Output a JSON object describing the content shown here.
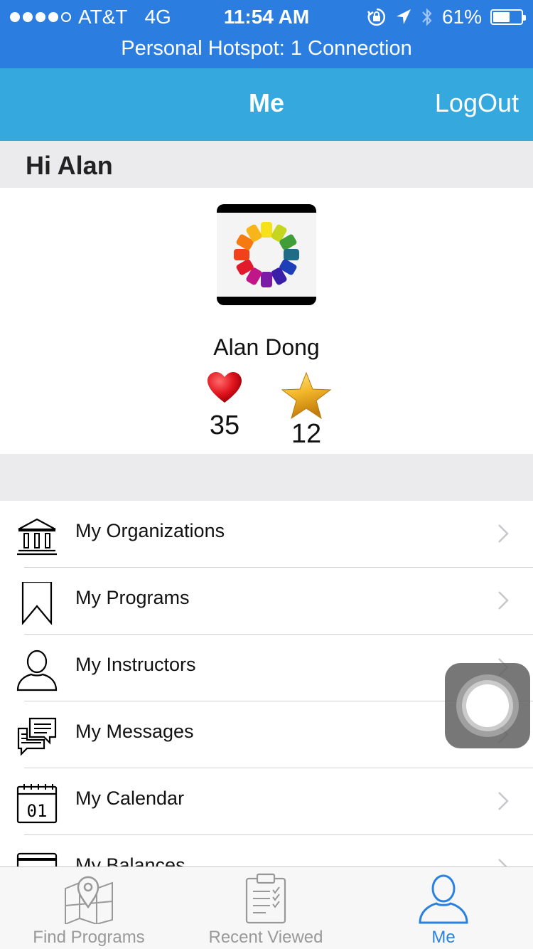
{
  "status_bar": {
    "carrier": "AT&T",
    "network": "4G",
    "time": "11:54 AM",
    "battery_percent_text": "61%",
    "battery_level": 0.61,
    "hotspot": "Personal Hotspot: 1 Connection"
  },
  "nav": {
    "title": "Me",
    "logout": "LogOut"
  },
  "greeting": "Hi Alan",
  "profile": {
    "name": "Alan Dong",
    "likes": "35",
    "stars": "12",
    "avatar_icon": "color-wheel"
  },
  "menu": {
    "items": [
      {
        "label": "My Organizations",
        "icon": "institution-icon"
      },
      {
        "label": "My Programs",
        "icon": "bookmark-icon"
      },
      {
        "label": "My Instructors",
        "icon": "person-icon"
      },
      {
        "label": "My Messages",
        "icon": "messages-icon"
      },
      {
        "label": "My Calendar",
        "icon": "calendar-icon"
      },
      {
        "label": "My Balances",
        "icon": "card-icon"
      }
    ]
  },
  "tabs": [
    {
      "label": "Find Programs",
      "icon": "map-pin-icon",
      "active": false
    },
    {
      "label": "Recent Viewed",
      "icon": "clipboard-icon",
      "active": false
    },
    {
      "label": "Me",
      "icon": "person-icon",
      "active": true
    }
  ],
  "colors": {
    "status_bar": "#2b7de0",
    "nav_bar": "#35a9dd",
    "tab_active": "#2a82e0",
    "tab_inactive": "#999999",
    "section_gray": "#ebebed"
  }
}
